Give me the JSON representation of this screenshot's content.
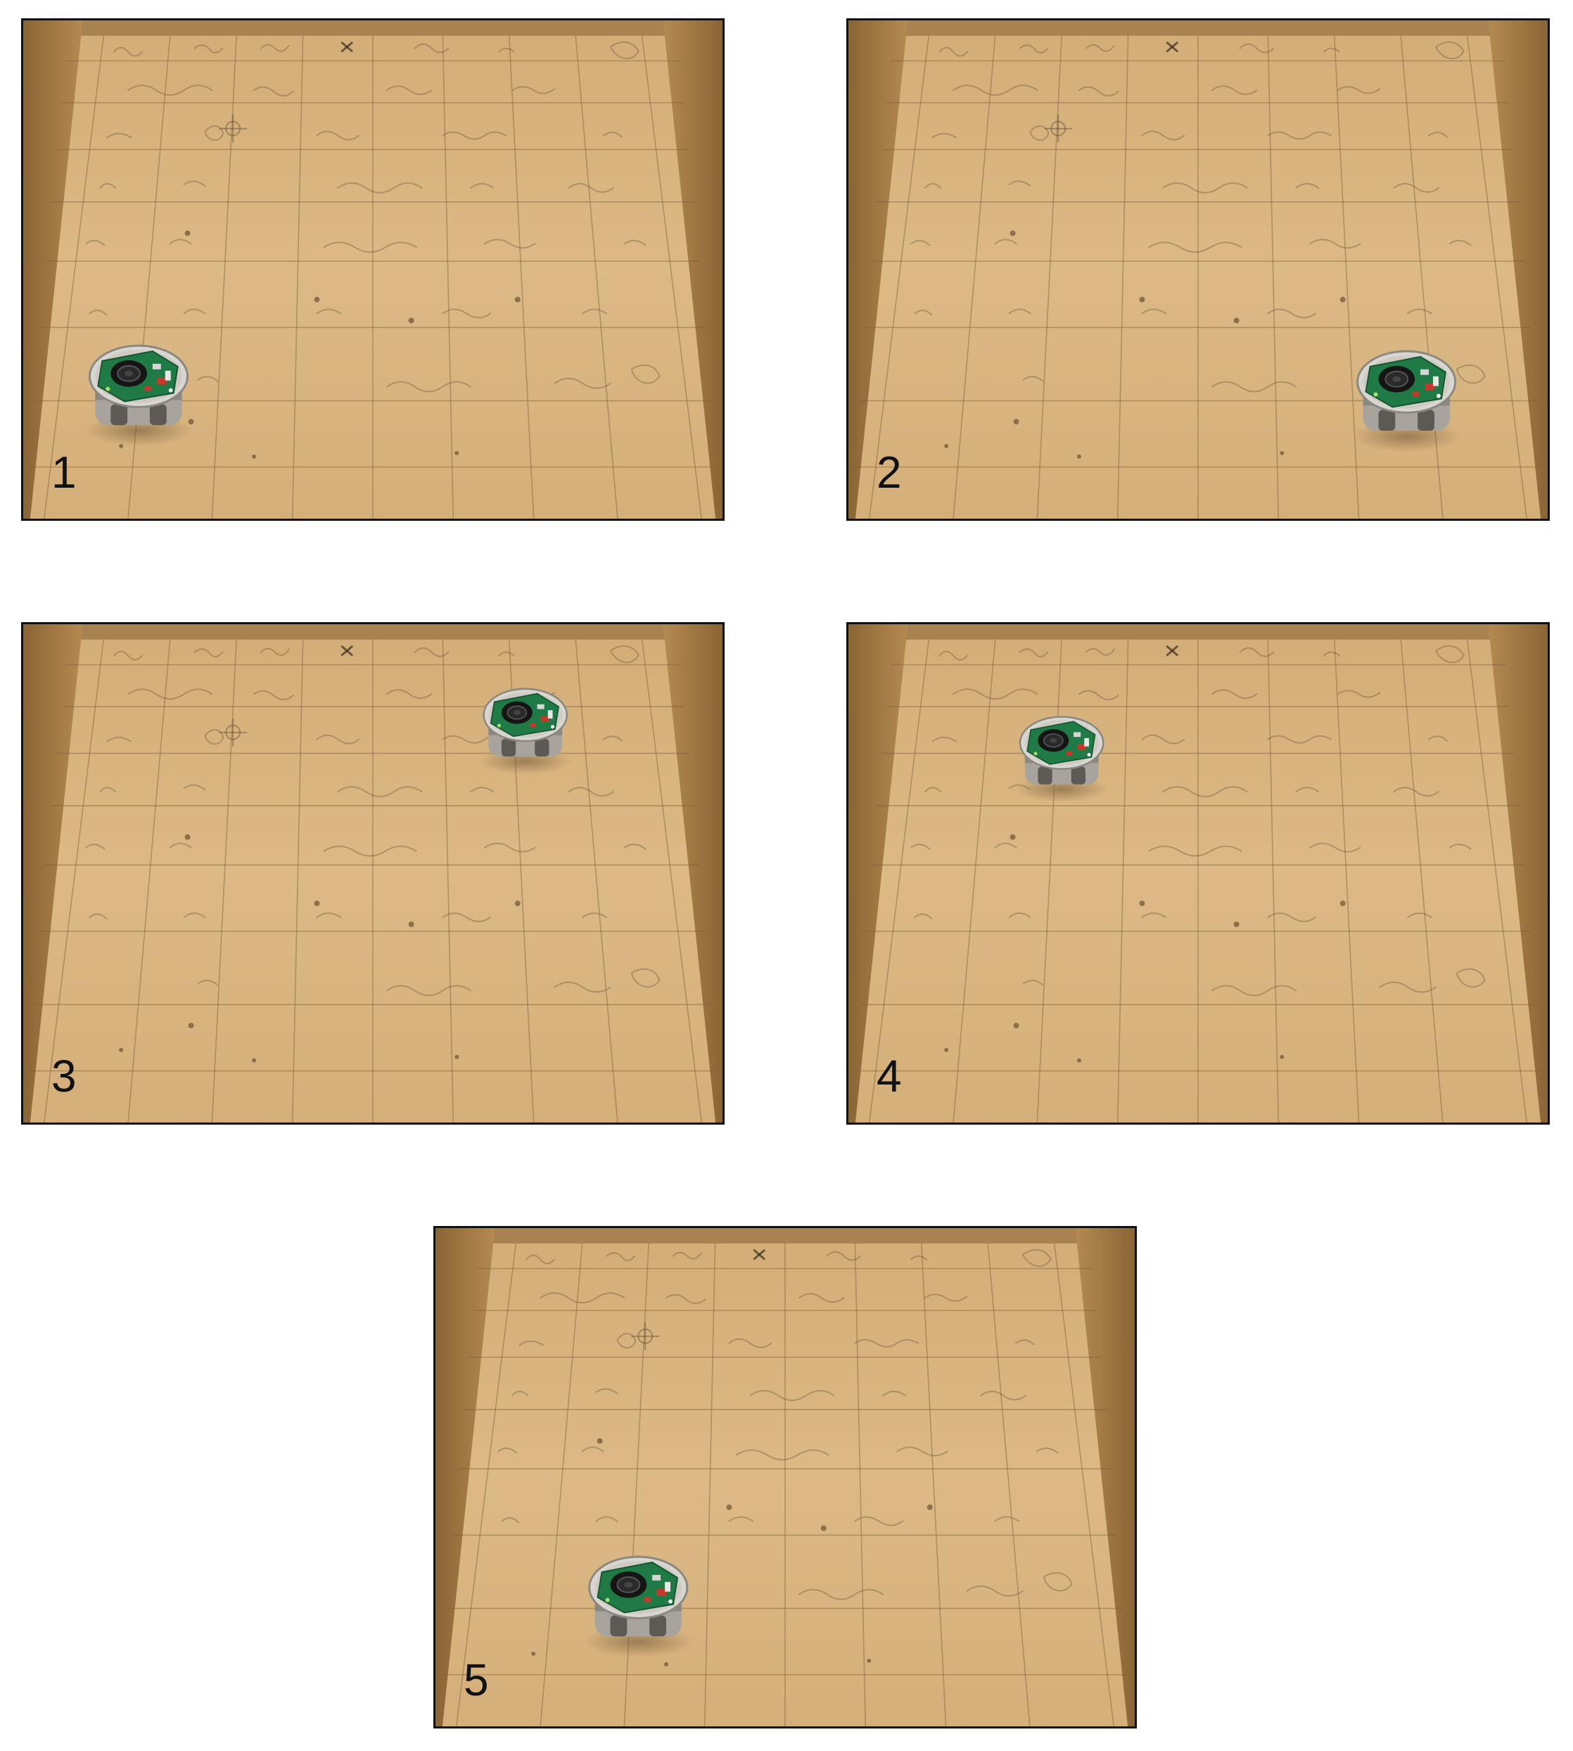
{
  "panels": [
    {
      "id": "1",
      "label": "1"
    },
    {
      "id": "2",
      "label": "2"
    },
    {
      "id": "3",
      "label": "3"
    },
    {
      "id": "4",
      "label": "4"
    },
    {
      "id": "5",
      "label": "5"
    }
  ],
  "colors": {
    "floor": "#d8b47f",
    "floor_light": "#e0c18f",
    "wall": "#9a7443",
    "grid_line": "#7a5e3a",
    "pencil": "#5c4a36",
    "robot_board": "#1f7a45",
    "robot_body": "#b9b6b0",
    "speaker": "#151515"
  }
}
